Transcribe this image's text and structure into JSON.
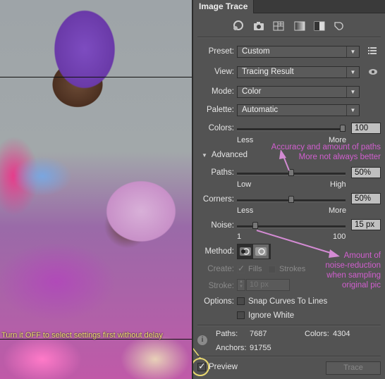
{
  "panel": {
    "tab": "Image Trace",
    "top_icons": [
      "auto-color-icon",
      "high-color-icon",
      "low-color-icon",
      "grayscale-icon",
      "black-white-icon",
      "outline-icon"
    ],
    "preset": {
      "label": "Preset:",
      "value": "Custom"
    },
    "view": {
      "label": "View:",
      "value": "Tracing Result"
    },
    "mode": {
      "label": "Mode:",
      "value": "Color"
    },
    "palette": {
      "label": "Palette:",
      "value": "Automatic"
    },
    "colors": {
      "label": "Colors:",
      "value": "100",
      "min_label": "Less",
      "max_label": "More",
      "position": 1.0
    },
    "advanced": {
      "label": "Advanced"
    },
    "paths": {
      "label": "Paths:",
      "value": "50%",
      "min_label": "Low",
      "max_label": "High",
      "position": 0.5
    },
    "corners": {
      "label": "Corners:",
      "value": "50%",
      "min_label": "Less",
      "max_label": "More",
      "position": 0.5
    },
    "noise": {
      "label": "Noise:",
      "value": "15 px",
      "min_label": "1",
      "max_label": "100",
      "position": 0.15
    },
    "method": {
      "label": "Method:"
    },
    "create": {
      "label": "Create:",
      "fills": "Fills",
      "strokes": "Strokes",
      "fills_checked": true,
      "strokes_checked": false
    },
    "stroke": {
      "label": "Stroke:",
      "value": "10 px"
    },
    "options": {
      "label": "Options:",
      "snap": "Snap Curves To Lines",
      "ignore_white": "Ignore White"
    },
    "stats": {
      "paths_label": "Paths:",
      "paths_value": "7687",
      "colors_label": "Colors:",
      "colors_value": "4304",
      "anchors_label": "Anchors:",
      "anchors_value": "91755"
    },
    "preview": {
      "label": "Preview",
      "checked": true
    },
    "trace_button": "Trace"
  },
  "annotations": {
    "paths_note_line1": "Accuracy and amount of paths",
    "paths_note_line2": "More not always better",
    "noise_note_line1": "Amount of",
    "noise_note_line2": "noise-reduction",
    "noise_note_line3": "when sampling",
    "noise_note_line4": "original pic",
    "preview_note": "Turn it OFF to select settings first without delay",
    "annotation_color": "#d15fcf",
    "preview_note_color": "#f0e070"
  }
}
